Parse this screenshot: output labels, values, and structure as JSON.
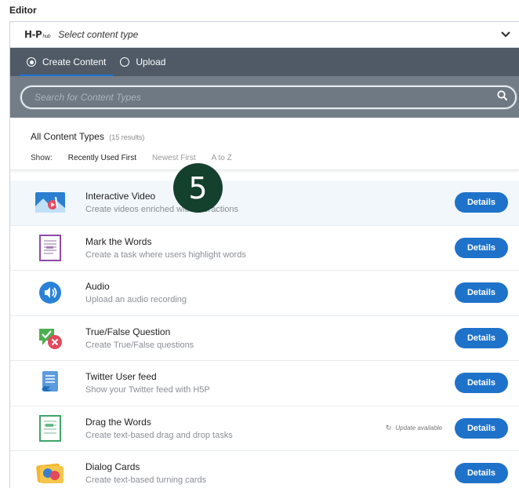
{
  "editor_label": "Editor",
  "selector": {
    "logo_main": "H-P",
    "logo_sub": "hub",
    "placeholder": "Select content type"
  },
  "tabs": [
    {
      "label": "Create Content",
      "active": true
    },
    {
      "label": "Upload",
      "active": false
    }
  ],
  "search": {
    "placeholder": "Search for Content Types",
    "value": ""
  },
  "results": {
    "title": "All Content Types",
    "count": "(15 results)",
    "show_label": "Show:",
    "sort_options": [
      "Recently Used First",
      "Newest First",
      "A to Z"
    ],
    "active_sort": "Recently Used First"
  },
  "items": [
    {
      "title": "Interactive Video",
      "description": "Create videos enriched with interactions",
      "icon": "interactive-video-icon",
      "button": "Details",
      "update": ""
    },
    {
      "title": "Mark the Words",
      "description": "Create a task where users highlight words",
      "icon": "mark-the-words-icon",
      "button": "Details",
      "update": ""
    },
    {
      "title": "Audio",
      "description": "Upload an audio recording",
      "icon": "audio-icon",
      "button": "Details",
      "update": ""
    },
    {
      "title": "True/False Question",
      "description": "Create True/False questions",
      "icon": "true-false-icon",
      "button": "Details",
      "update": ""
    },
    {
      "title": "Twitter User feed",
      "description": "Show your Twitter feed with H5P",
      "icon": "twitter-feed-icon",
      "button": "Details",
      "update": ""
    },
    {
      "title": "Drag the Words",
      "description": "Create text-based drag and drop tasks",
      "icon": "drag-the-words-icon",
      "button": "Details",
      "update": "Update available"
    },
    {
      "title": "Dialog Cards",
      "description": "Create text-based turning cards",
      "icon": "dialog-cards-icon",
      "button": "Details",
      "update": ""
    }
  ],
  "step_badge": "5",
  "colors": {
    "tab_bar": "#4f5a66",
    "search_bar": "#737d87",
    "accent": "#1f72c9",
    "badge": "#14402e"
  }
}
